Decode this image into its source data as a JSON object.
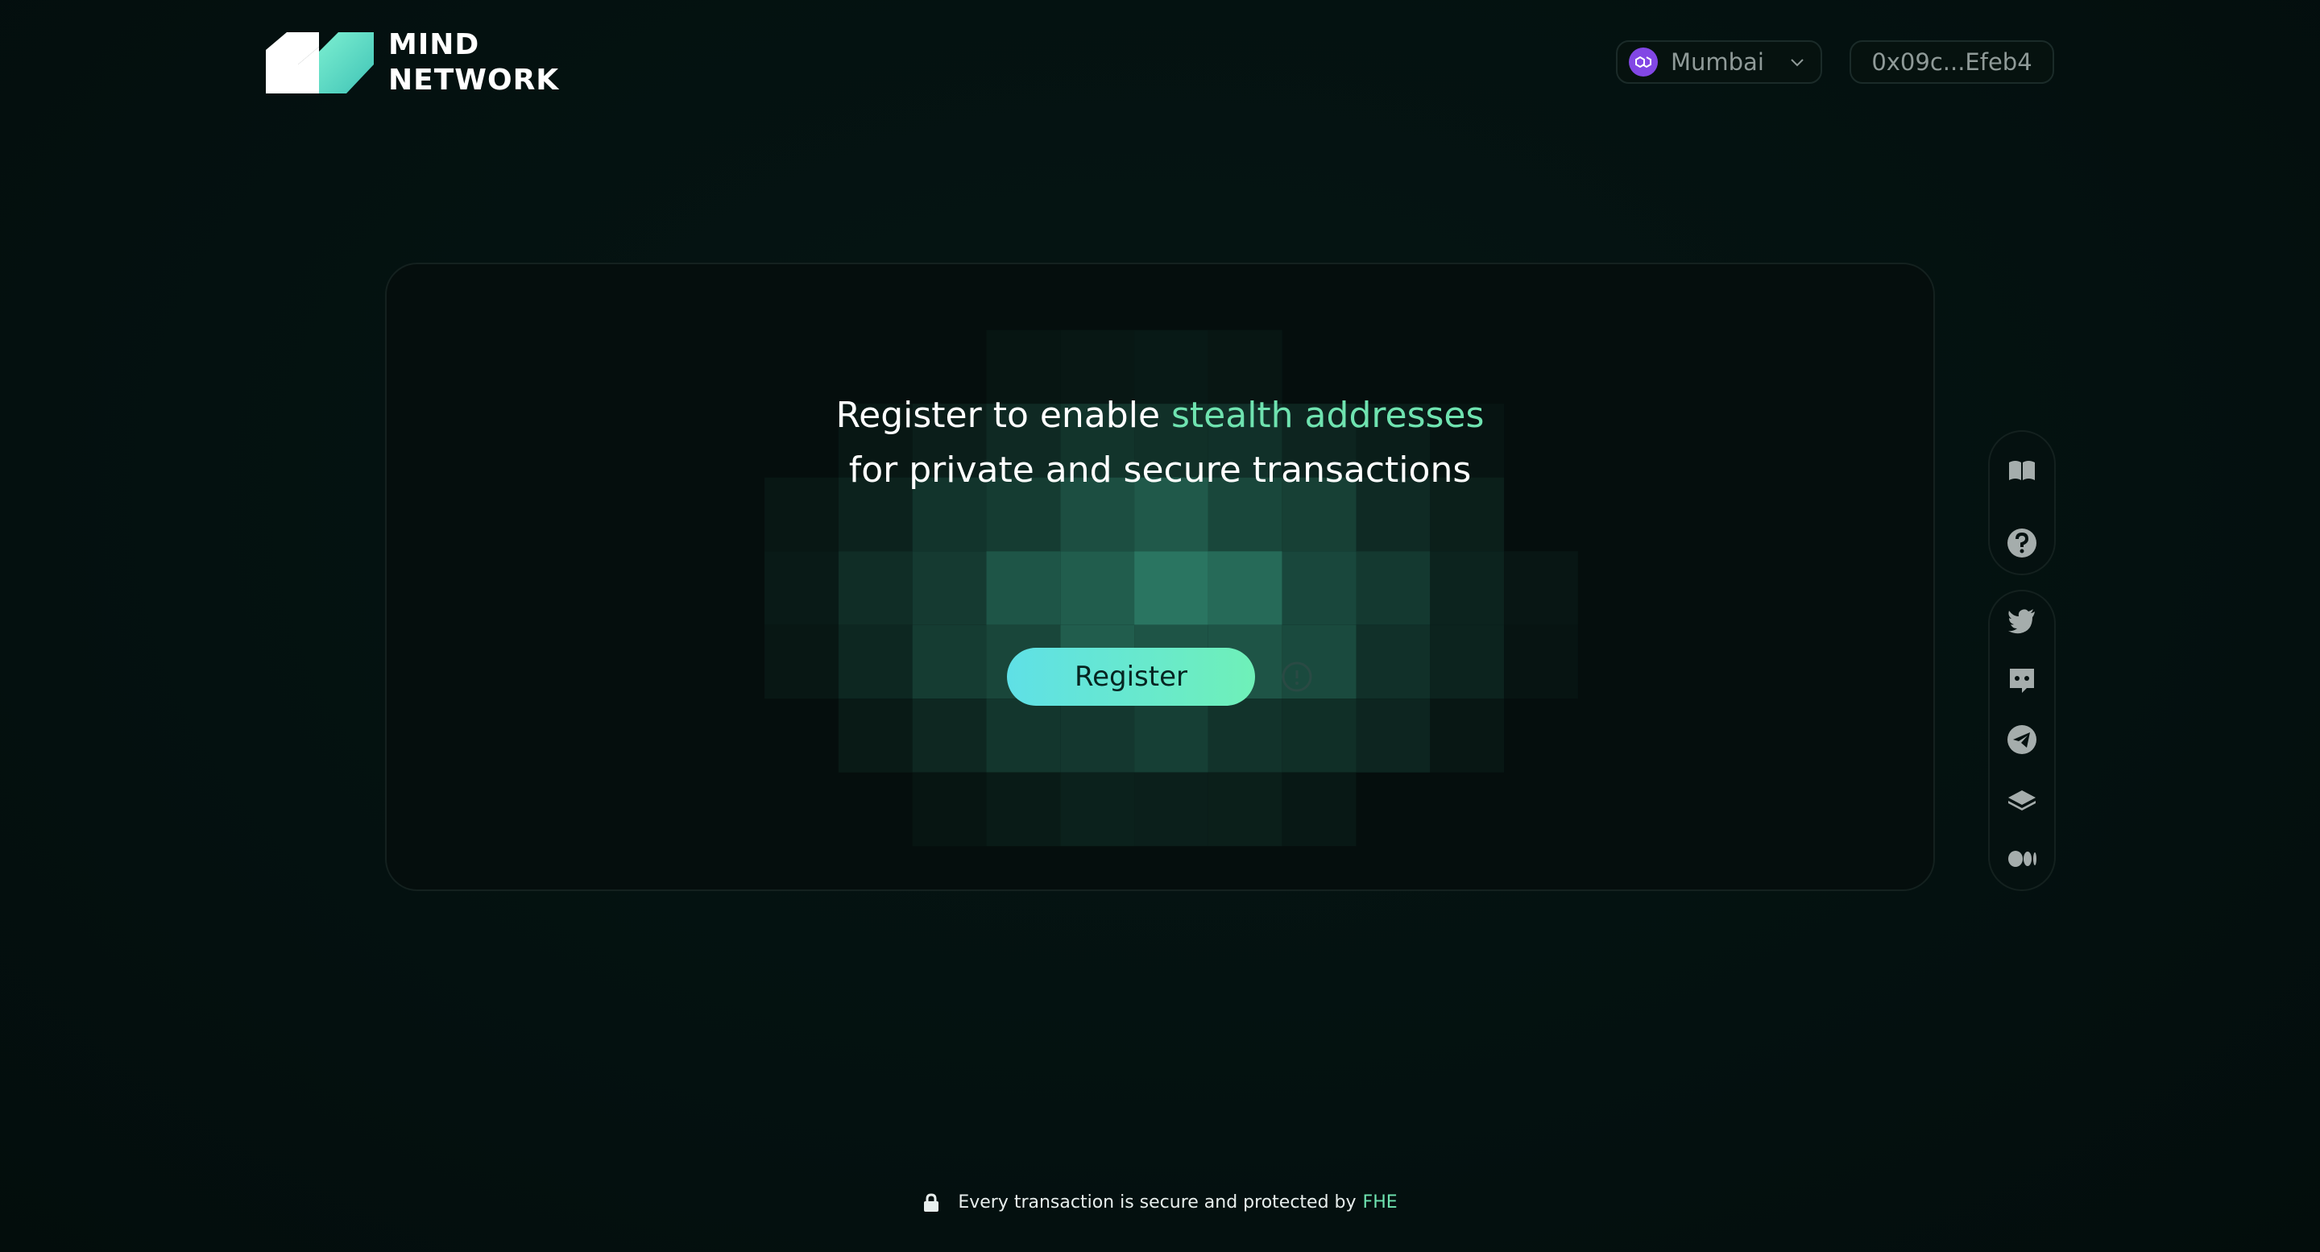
{
  "brand": {
    "line1": "MIND",
    "line2": "NETWORK"
  },
  "header": {
    "network_label": "Mumbai",
    "wallet_address": "0x09c...Efeb4"
  },
  "hero": {
    "headline_part1": "Register to enable ",
    "headline_accent": "stealth addresses",
    "headline_line2": "for private and secure transactions",
    "register_label": "Register"
  },
  "rail": {
    "top_icons": [
      "docs-book-icon",
      "help-icon"
    ],
    "social_icons": [
      "twitter-icon",
      "discord-icon",
      "telegram-icon",
      "gitbook-icon",
      "medium-icon"
    ]
  },
  "footer": {
    "text": "Every transaction is secure and protected by",
    "accent": "FHE"
  },
  "colors": {
    "background": "#04100f",
    "accent": "#6fe3b0",
    "button_gradient_start": "#5fe0e6",
    "button_gradient_end": "#6ff0b8",
    "network_icon": "#8247e5"
  }
}
